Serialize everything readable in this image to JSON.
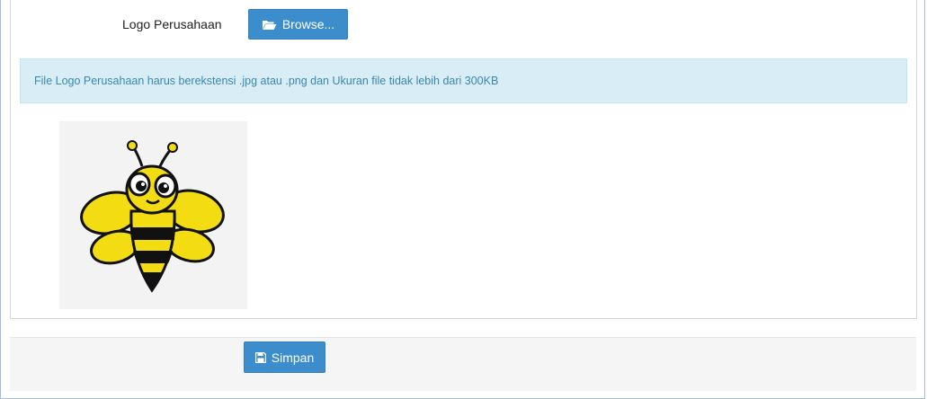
{
  "form": {
    "logo_label": "Logo Perusahaan",
    "browse_label": "Browse...",
    "info_text": "File Logo Perusahaan harus berekstensi .jpg atau .png dan Ukuran file tidak lebih dari 300KB",
    "save_label": "Simpan"
  },
  "icons": {
    "browse": "folder-open-icon",
    "save": "floppy-disk-icon"
  },
  "colors": {
    "primary_button": "#3c8dcc",
    "alert_bg": "#d9edf7",
    "alert_text": "#3a87ad"
  }
}
